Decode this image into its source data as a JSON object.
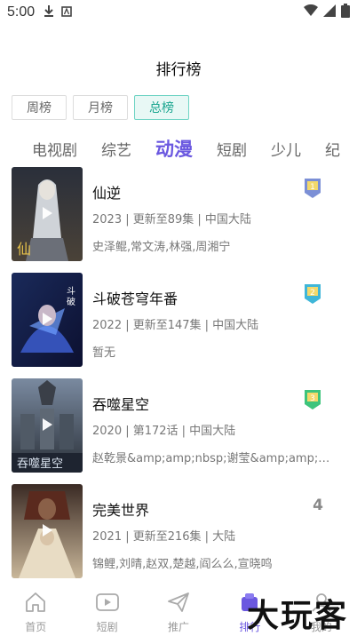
{
  "status": {
    "time": "5:00"
  },
  "header": {
    "title": "排行榜"
  },
  "periods": [
    {
      "label": "周榜",
      "active": false
    },
    {
      "label": "月榜",
      "active": false
    },
    {
      "label": "总榜",
      "active": true
    }
  ],
  "categories": [
    {
      "label": "：",
      "active": false
    },
    {
      "label": "电视剧",
      "active": false
    },
    {
      "label": "综艺",
      "active": false
    },
    {
      "label": "动漫",
      "active": true
    },
    {
      "label": "短剧",
      "active": false
    },
    {
      "label": "少儿",
      "active": false
    },
    {
      "label": "纪",
      "active": false
    }
  ],
  "items": [
    {
      "name": "仙逆",
      "meta": "2023 | 更新至89集 | 中国大陆",
      "cast": "史泽鲲,常文涛,林强,周湘宁",
      "rank": "1",
      "rank_color": "#7b8fd6"
    },
    {
      "name": "斗破苍穹年番",
      "meta": "2022 | 更新至147集 | 中国大陆",
      "cast": "暂无",
      "rank": "2",
      "rank_color": "#3fb6d8"
    },
    {
      "name": "吞噬星空",
      "meta": "2020 | 第172话 | 中国大陆",
      "cast": "赵乾景&amp;amp;nbsp;谢莹&amp;amp;nbsp;",
      "rank": "3",
      "rank_color": "#3ec47c"
    },
    {
      "name": "完美世界",
      "meta": "2021 | 更新至216集 | 大陆",
      "cast": "锦鲤,刘晴,赵双,楚越,阎么么,宣晓鸣",
      "rank": "4",
      "rank_color": "#888888"
    }
  ],
  "tabbar": [
    {
      "label": "首页",
      "icon": "home-icon",
      "active": false
    },
    {
      "label": "短剧",
      "icon": "play-box-icon",
      "active": false
    },
    {
      "label": "推广",
      "icon": "paper-plane-icon",
      "active": false
    },
    {
      "label": "排行",
      "icon": "ranking-icon",
      "active": true
    },
    {
      "label": "我的",
      "icon": "profile-icon",
      "active": false
    }
  ],
  "watermark": "大玩客",
  "colors": {
    "accent": "#6b58e0",
    "teal": "#19a58f"
  }
}
